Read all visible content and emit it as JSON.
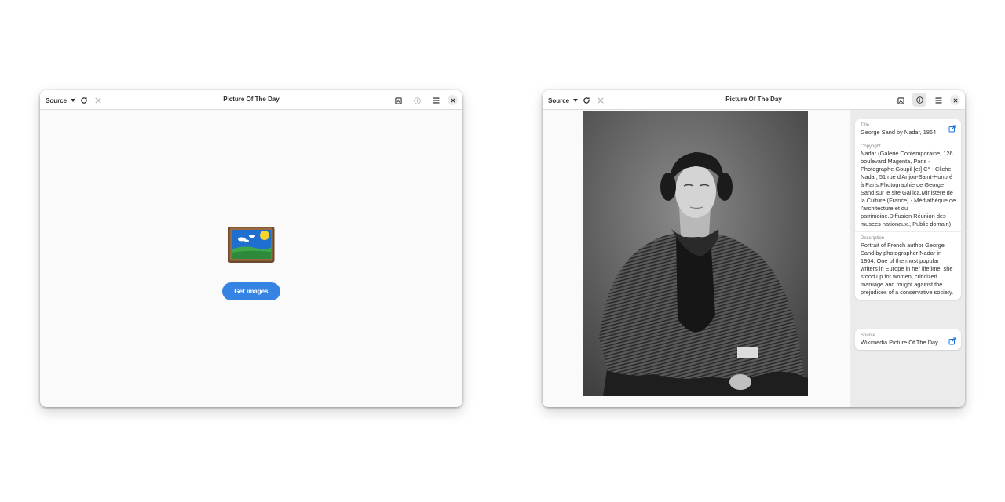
{
  "windows": [
    {
      "headerbar": {
        "source_label": "Source",
        "title": "Picture Of The Day"
      },
      "empty_state": {
        "button_label": "Get images"
      }
    },
    {
      "headerbar": {
        "source_label": "Source",
        "title": "Picture Of The Day"
      },
      "info": {
        "title_label": "Title",
        "title_value": "George Sand by Nadar, 1864",
        "copyright_label": "Copyright",
        "copyright_value": "Nadar (Galerie Contemporaine, 126 boulevard Magenta, Paris - Photographe Goupil [et] C° - Cliche Nadar, 51 rue d'Anjou-Saint-Honoré à Paris.Photographie de George Sand sur le site Gallica.Ministere de la Culture (France) - Médiathèque de l'architecture et du patrimoine.Diffusion Réunion des musees nationaux., Public domain)",
        "description_label": "Description",
        "description_value": "Portrait of French author George Sand by photographer Nadar in 1864. One of the most popular writers in Europe in her lifetime, she stood up for women, criticized marriage and fought against the prejudices of a conservative society.",
        "source_label": "Source",
        "source_value": "Wikimedia Picture Of The Day"
      }
    }
  ],
  "colors": {
    "accent": "#3584e4",
    "headerbar": "#ffffff",
    "window_bg": "#fafafa",
    "sidebar_bg": "#ebebeb",
    "text": "#2e2e2e",
    "dim_label": "#8a8a8a"
  },
  "icons": {
    "source_dropdown": "pan-down-icon",
    "reload": "view-refresh-icon",
    "stop": "process-stop-icon",
    "set_wallpaper": "image-icon",
    "info": "info-icon",
    "menu": "open-menu-icon",
    "close": "window-close-icon",
    "external_link": "external-link-icon",
    "empty_state": "picture-frame-icon"
  }
}
